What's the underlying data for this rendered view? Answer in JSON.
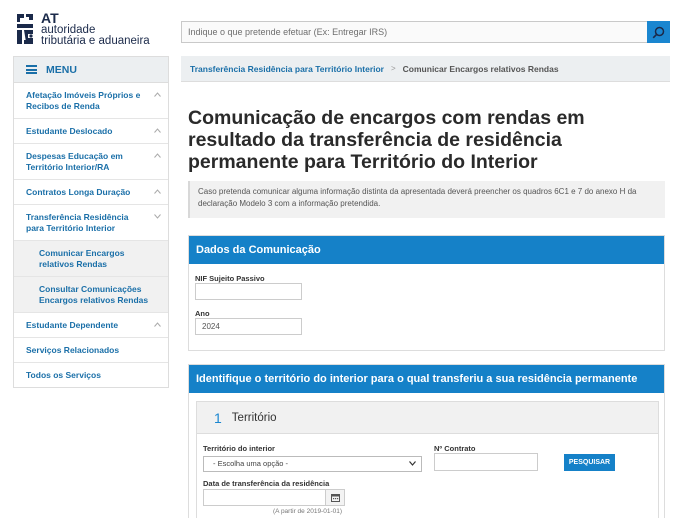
{
  "brand": {
    "at": "AT",
    "line1": "autoridade",
    "line2": "tributária e aduaneira"
  },
  "search": {
    "placeholder": "Indique o que pretende efetuar (Ex: Entregar IRS)",
    "icon": "search-icon"
  },
  "sidebar": {
    "menu_label": "MENU",
    "items": [
      {
        "label": "Afetação Imóveis Próprios e Recibos de Renda",
        "chevron": "up"
      },
      {
        "label": "Estudante Deslocado",
        "chevron": "up"
      },
      {
        "label": "Despesas Educação em Território Interior/RA",
        "chevron": "up"
      },
      {
        "label": "Contratos Longa Duração",
        "chevron": "up"
      },
      {
        "label": "Transferência Residência para Território Interior",
        "chevron": "down"
      }
    ],
    "subitems": [
      {
        "label": "Comunicar Encargos relativos Rendas"
      },
      {
        "label": "Consultar Comunicações Encargos relativos Rendas"
      }
    ],
    "items_after": [
      {
        "label": "Estudante Dependente",
        "chevron": "up"
      },
      {
        "label": "Serviços Relacionados"
      },
      {
        "label": "Todos os Serviços"
      }
    ]
  },
  "breadcrumb": {
    "parent": "Transferência Residência para Território Interior",
    "separator": ">",
    "current": "Comunicar Encargos relativos Rendas"
  },
  "page": {
    "title": "Comunicação de encargos com rendas em resultado da transferência de residência permanente para Território do Interior",
    "info": "Caso pretenda comunicar alguma informação distinta da apresentada deverá preencher os quadros 6C1 e 7 do anexo H da declaração Modelo 3 com a informação pretendida."
  },
  "dados": {
    "title": "Dados da Comunicação",
    "nif_label": "NIF Sujeito Passivo",
    "nif_value": "",
    "ano_label": "Ano",
    "ano_value": "2024"
  },
  "territorio": {
    "title": "Identifique o território do interior para o qual transferiu a sua residência permanente",
    "step_number": "1",
    "step_title": "Território",
    "select_label": "Território do interior",
    "select_value": "- Escolha uma opção -",
    "contract_label": "Nº Contrato",
    "contract_value": "",
    "search_button": "PESQUISAR",
    "date_label": "Data de transferência da residência",
    "date_value": "",
    "date_hint": "(A partir de 2019-01-01)"
  },
  "colors": {
    "primary": "#1581c8",
    "link": "#1a6fa8",
    "header_bg": "#eceff1"
  }
}
